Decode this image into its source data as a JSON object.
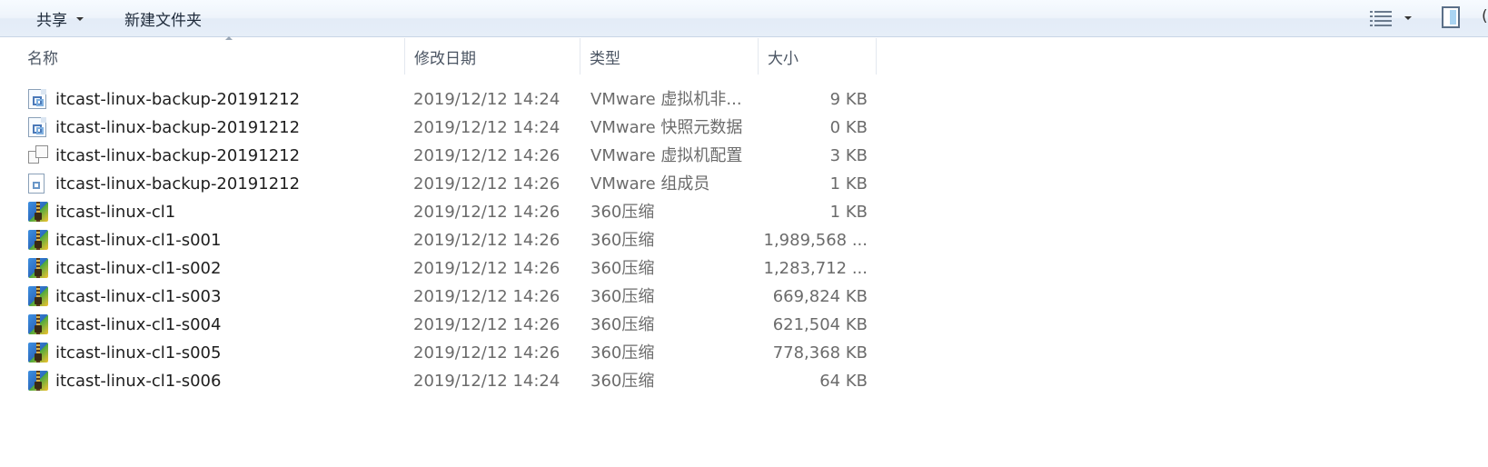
{
  "toolbar": {
    "share_label": "共享",
    "new_folder_label": "新建文件夹",
    "right_edge_label": "("
  },
  "columns": {
    "name": "名称",
    "date": "修改日期",
    "type": "类型",
    "size": "大小"
  },
  "files": [
    {
      "name": "itcast-linux-backup-20191212",
      "date": "2019/12/12 14:24",
      "type": "VMware 虚拟机非...",
      "size": "9 KB",
      "icon": "vmware-vm-icon"
    },
    {
      "name": "itcast-linux-backup-20191212",
      "date": "2019/12/12 14:24",
      "type": "VMware 快照元数据",
      "size": "0 KB",
      "icon": "vmware-vm-icon"
    },
    {
      "name": "itcast-linux-backup-20191212",
      "date": "2019/12/12 14:26",
      "type": "VMware 虚拟机配置",
      "size": "3 KB",
      "icon": "vmware-config-icon"
    },
    {
      "name": "itcast-linux-backup-20191212",
      "date": "2019/12/12 14:26",
      "type": "VMware 组成员",
      "size": "1 KB",
      "icon": "vmware-team-icon"
    },
    {
      "name": "itcast-linux-cl1",
      "date": "2019/12/12 14:26",
      "type": "360压缩",
      "size": "1 KB",
      "icon": "zip-archive-icon"
    },
    {
      "name": "itcast-linux-cl1-s001",
      "date": "2019/12/12 14:26",
      "type": "360压缩",
      "size": "1,989,568 ...",
      "icon": "zip-archive-icon"
    },
    {
      "name": "itcast-linux-cl1-s002",
      "date": "2019/12/12 14:26",
      "type": "360压缩",
      "size": "1,283,712 ...",
      "icon": "zip-archive-icon"
    },
    {
      "name": "itcast-linux-cl1-s003",
      "date": "2019/12/12 14:26",
      "type": "360压缩",
      "size": "669,824 KB",
      "icon": "zip-archive-icon"
    },
    {
      "name": "itcast-linux-cl1-s004",
      "date": "2019/12/12 14:26",
      "type": "360压缩",
      "size": "621,504 KB",
      "icon": "zip-archive-icon"
    },
    {
      "name": "itcast-linux-cl1-s005",
      "date": "2019/12/12 14:26",
      "type": "360压缩",
      "size": "778,368 KB",
      "icon": "zip-archive-icon"
    },
    {
      "name": "itcast-linux-cl1-s006",
      "date": "2019/12/12 14:24",
      "type": "360压缩",
      "size": "64 KB",
      "icon": "zip-archive-icon"
    }
  ]
}
